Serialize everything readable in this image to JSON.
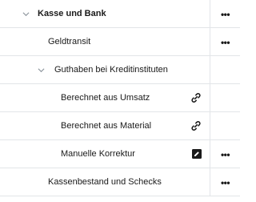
{
  "tree": {
    "rows": [
      {
        "label": "Kasse und Bank"
      },
      {
        "label": "Geldtransit"
      },
      {
        "label": "Guthaben bei Kreditinstituten"
      },
      {
        "label": "Berechnet aus Umsatz",
        "status_icon": "link-icon"
      },
      {
        "label": "Berechnet aus Material",
        "status_icon": "link-icon"
      },
      {
        "label": "Manuelle Korrektur",
        "status_icon": "edit-icon"
      },
      {
        "label": "Kassenbestand und Schecks"
      }
    ],
    "more_label": "•••"
  }
}
